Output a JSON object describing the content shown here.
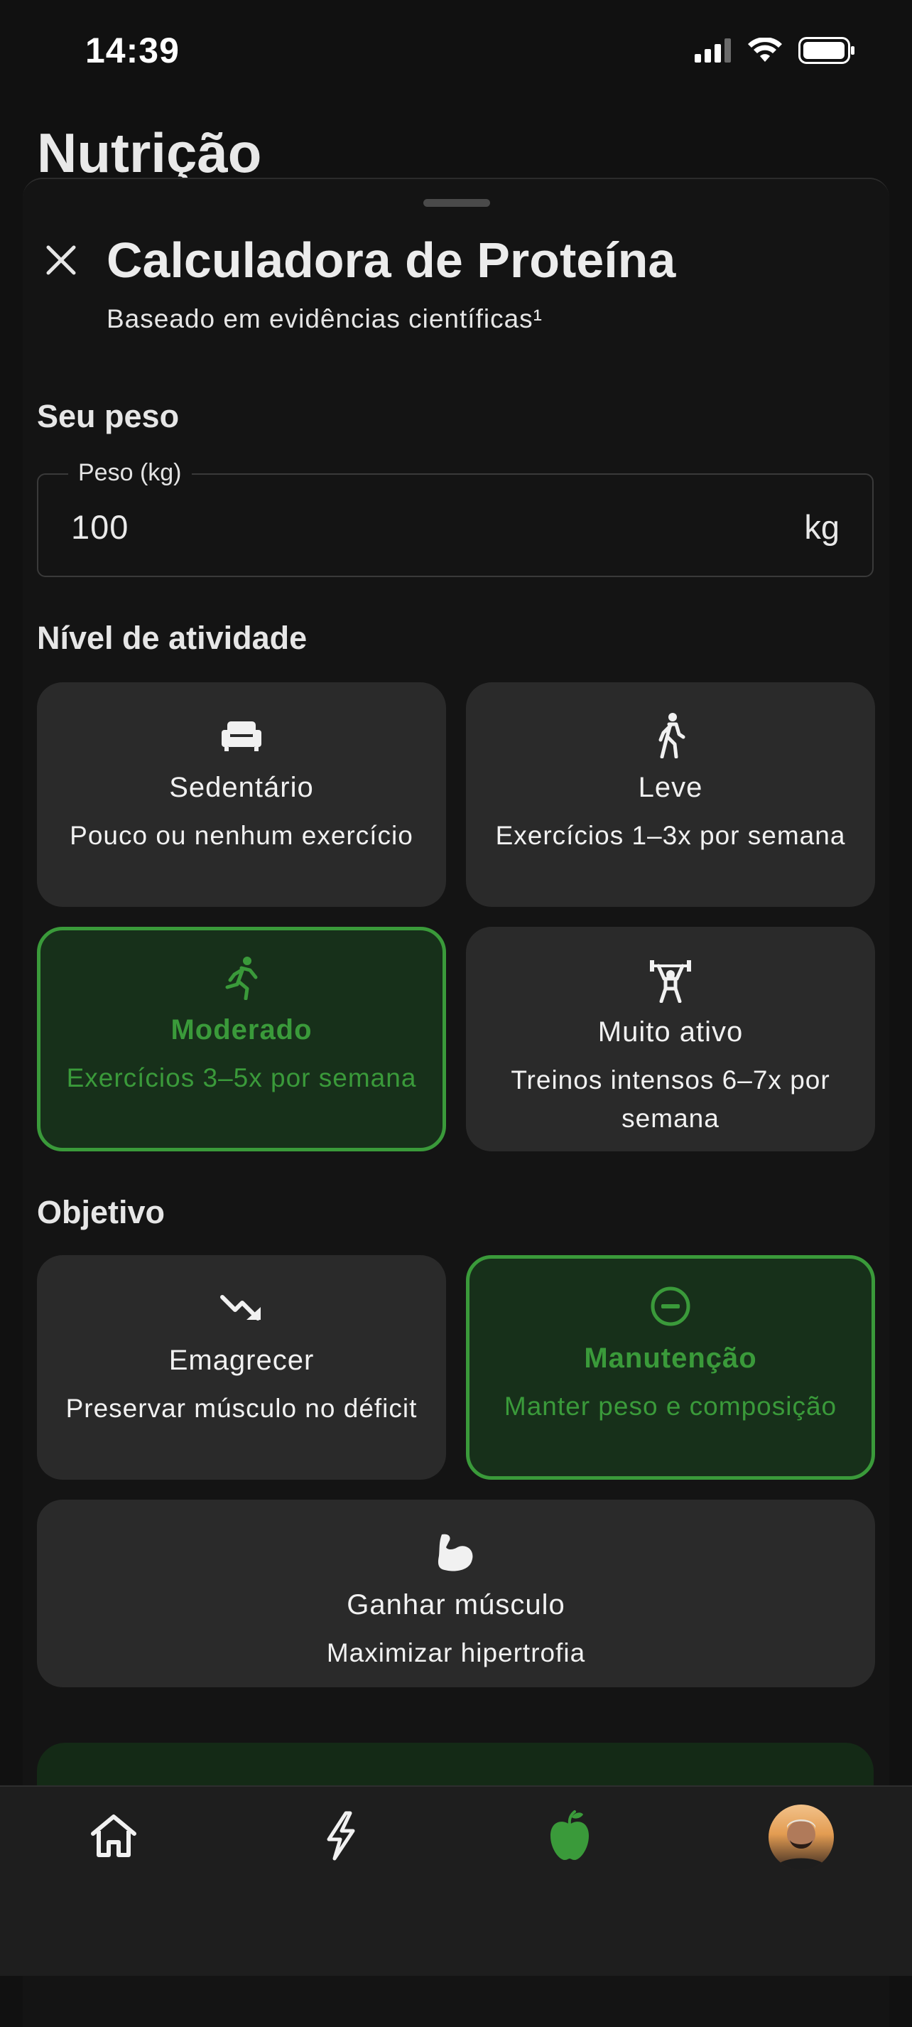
{
  "status_bar": {
    "time": "14:39"
  },
  "page": {
    "title": "Nutrição"
  },
  "sheet": {
    "title": "Calculadora de Proteína",
    "subtitle": "Baseado em evidências científicas¹"
  },
  "weight": {
    "section_label": "Seu peso",
    "field_label": "Peso (kg)",
    "value": "100",
    "unit": "kg"
  },
  "activity": {
    "section_label": "Nível de atividade",
    "options": [
      {
        "icon": "sofa-icon",
        "title": "Sedentário",
        "desc": "Pouco ou nenhum exercício",
        "selected": false
      },
      {
        "icon": "walking-icon",
        "title": "Leve",
        "desc": "Exercícios 1–3x por semana",
        "selected": false
      },
      {
        "icon": "running-icon",
        "title": "Moderado",
        "desc": "Exercícios 3–5x por semana",
        "selected": true
      },
      {
        "icon": "weightlifting-icon",
        "title": "Muito ativo",
        "desc": "Treinos intensos 6–7x por semana",
        "selected": false
      }
    ]
  },
  "goal": {
    "section_label": "Objetivo",
    "options": [
      {
        "icon": "trending-down-icon",
        "title": "Emagrecer",
        "desc": "Preservar músculo no déficit",
        "selected": false
      },
      {
        "icon": "minus-circle-icon",
        "title": "Manutenção",
        "desc": "Manter peso e composição",
        "selected": true
      },
      {
        "icon": "flexed-biceps-icon",
        "title": "Ganhar músculo",
        "desc": "Maximizar hipertrofia",
        "selected": false
      }
    ]
  },
  "tabs": [
    {
      "icon": "home-icon",
      "active": false
    },
    {
      "icon": "lightning-icon",
      "active": false
    },
    {
      "icon": "apple-icon",
      "active": true
    },
    {
      "icon": "avatar",
      "active": false
    }
  ],
  "colors": {
    "background": "#111111",
    "card": "#2a2a2a",
    "accent_green": "#3a9a3a",
    "selected_card_bg": "#17301a",
    "tabbar": "#1e1e1e"
  }
}
